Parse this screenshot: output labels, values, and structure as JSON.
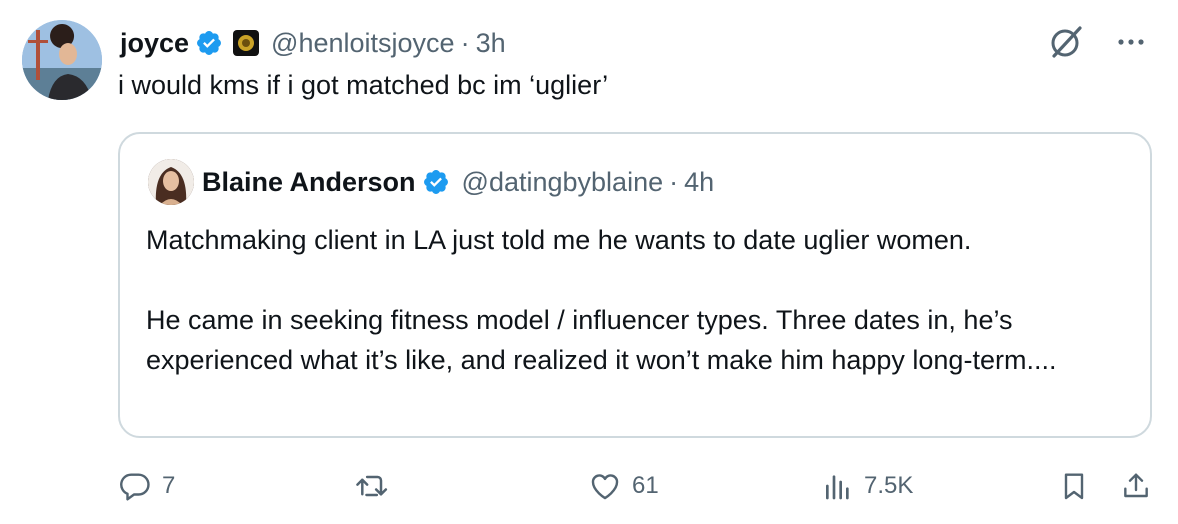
{
  "tweet": {
    "author_name": "joyce",
    "handle": "@henloitsjoyce",
    "separator": "·",
    "time": "3h",
    "text": "i would kms if i got matched bc im ‘uglier’"
  },
  "quoted": {
    "author_name": "Blaine Anderson",
    "handle": "@datingbyblaine",
    "separator": "·",
    "time": "4h",
    "paragraphs": [
      "Matchmaking client in LA just told me he wants to date uglier women.",
      "He came in seeking fitness model / influencer types. Three dates in, he’s experienced what it’s like, and realized it won’t make him happy long-term...."
    ]
  },
  "actions": {
    "replies": "7",
    "reposts": "",
    "likes": "61",
    "views": "7.5K"
  },
  "colors": {
    "verified": "#1d9bf0",
    "muted": "#536471",
    "border": "#cfd9de"
  },
  "icons": [
    "verified-badge-icon",
    "affiliate-badge-icon",
    "grok-icon",
    "more-icon",
    "reply-icon",
    "repost-icon",
    "like-icon",
    "views-icon",
    "bookmark-icon",
    "share-icon"
  ]
}
